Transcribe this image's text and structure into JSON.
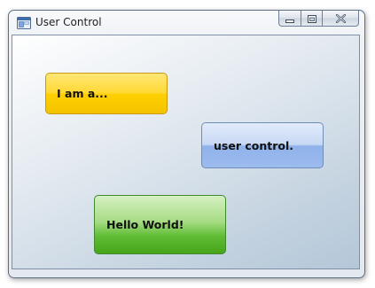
{
  "window": {
    "title": "User Control",
    "icons": {
      "app": "application-icon",
      "minimize": "minimize-icon",
      "maximize": "maximize-icon",
      "close": "close-icon"
    }
  },
  "buttons": {
    "first_label": "I am a...",
    "second_label": "user control.",
    "third_label": "Hello World!"
  },
  "colors": {
    "yellow_button": "#ffd934",
    "blue_button": "#c8d9f5",
    "green_button": "#5fbc34"
  }
}
